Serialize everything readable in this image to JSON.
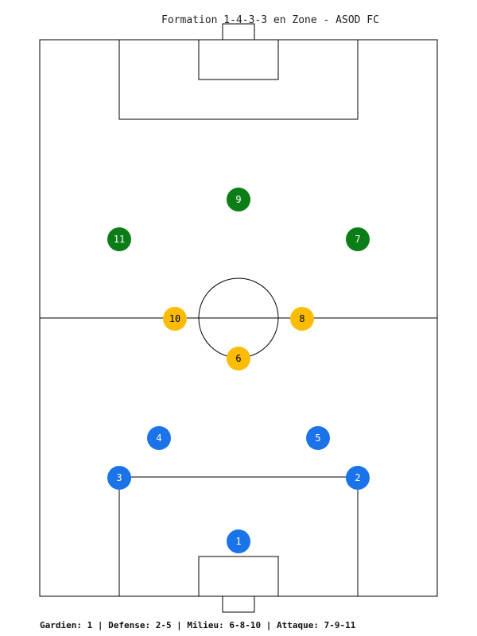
{
  "title": "Formation 1-4-3-3 en Zone - ASOD FC",
  "footer": "Gardien: 1 | Defense: 2-5 | Milieu: 6-8-10 | Attaque: 7-9-11",
  "colors": {
    "defense": "#1a73e8",
    "midfield": "#fbbc05",
    "attack": "#0a7d16",
    "line": "#000000"
  },
  "players": [
    {
      "number": "1",
      "role": "goalkeeper"
    },
    {
      "number": "2",
      "role": "defense"
    },
    {
      "number": "3",
      "role": "defense"
    },
    {
      "number": "4",
      "role": "defense"
    },
    {
      "number": "5",
      "role": "defense"
    },
    {
      "number": "6",
      "role": "midfield"
    },
    {
      "number": "8",
      "role": "midfield"
    },
    {
      "number": "10",
      "role": "midfield"
    },
    {
      "number": "7",
      "role": "attack"
    },
    {
      "number": "9",
      "role": "attack"
    },
    {
      "number": "11",
      "role": "attack"
    }
  ]
}
